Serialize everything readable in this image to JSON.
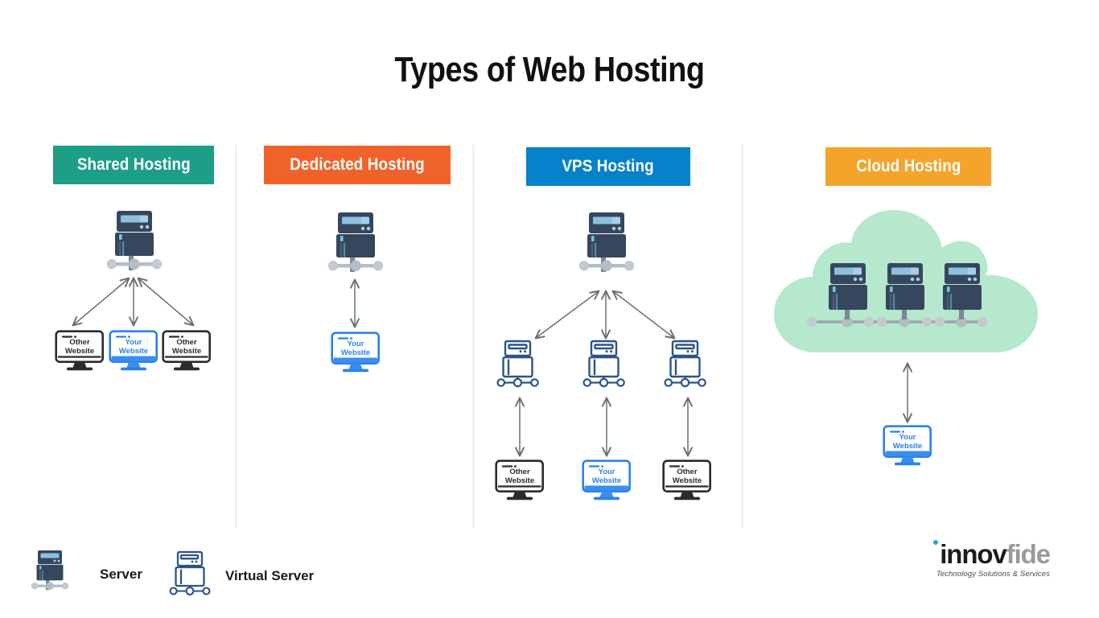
{
  "title": "Types of Web Hosting",
  "colors": {
    "shared": "#1d9e87",
    "dedicated": "#f1622a",
    "vps": "#0682ca",
    "cloud_header": "#f5a42b",
    "cloud_shape": "#b5e8cd",
    "server_body": "#36465c",
    "server_screen": "#a8cfe8",
    "virtual_server": "#2c5486",
    "your_website": "#2b82e8",
    "other_website": "#2b2b2b",
    "arrow": "#6e6e6e",
    "divider": "#f0f0f0",
    "logo_innov": "#1c1c1c",
    "logo_fide": "#9a9a9a",
    "logo_dot": "#29a3e0"
  },
  "columns": [
    {
      "id": "shared",
      "label": "Shared Hosting",
      "servers": 1,
      "virtual_servers": 0,
      "websites": [
        {
          "line1": "Other",
          "line2": "Website",
          "highlight": false
        },
        {
          "line1": "Your",
          "line2": "Website",
          "highlight": true
        },
        {
          "line1": "Other",
          "line2": "Website",
          "highlight": false
        }
      ]
    },
    {
      "id": "dedicated",
      "label": "Dedicated Hosting",
      "servers": 1,
      "virtual_servers": 0,
      "websites": [
        {
          "line1": "Your",
          "line2": "Website",
          "highlight": true
        }
      ]
    },
    {
      "id": "vps",
      "label": "VPS Hosting",
      "servers": 1,
      "virtual_servers": 3,
      "websites": [
        {
          "line1": "Other",
          "line2": "Website",
          "highlight": false
        },
        {
          "line1": "Your",
          "line2": "Website",
          "highlight": true
        },
        {
          "line1": "Other",
          "line2": "Website",
          "highlight": false
        }
      ]
    },
    {
      "id": "cloud",
      "label": "Cloud Hosting",
      "servers": 3,
      "virtual_servers": 0,
      "websites": [
        {
          "line1": "Your",
          "line2": "Website",
          "highlight": true
        }
      ]
    }
  ],
  "legend": [
    {
      "icon": "server-icon",
      "label": "Server"
    },
    {
      "icon": "virtual-server-icon",
      "label": "Virtual Server"
    }
  ],
  "logo": {
    "part1": "innov",
    "part2": "fide",
    "tagline": "Technology Solutions & Services"
  }
}
